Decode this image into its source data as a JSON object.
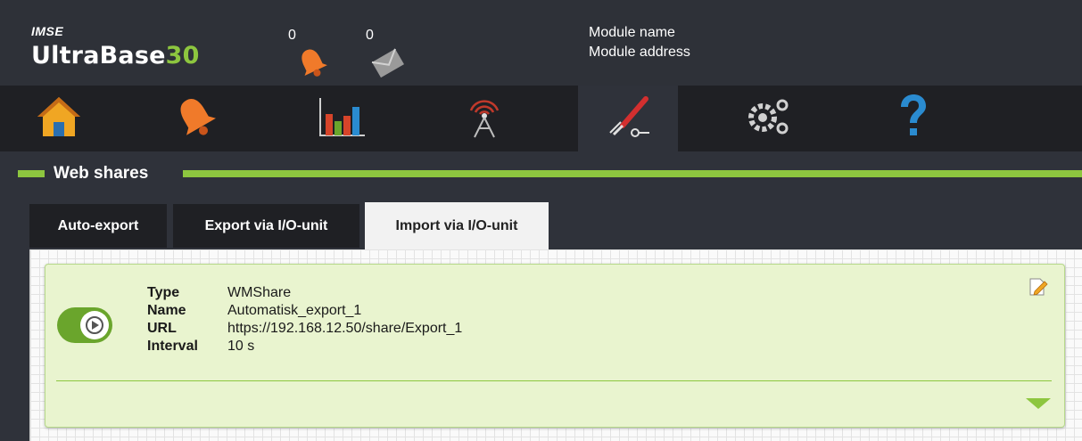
{
  "header": {
    "brand_small": "IMSE",
    "brand_name": "UltraBase",
    "brand_number": "30",
    "alarm_count": "0",
    "message_count": "0",
    "module_name": "Module name",
    "module_address": "Module address"
  },
  "nav": {
    "items": [
      {
        "name": "home-icon"
      },
      {
        "name": "alarm-bell-icon"
      },
      {
        "name": "bar-chart-icon"
      },
      {
        "name": "antenna-icon"
      },
      {
        "name": "tools-icon"
      },
      {
        "name": "gears-icon"
      },
      {
        "name": "help-icon"
      }
    ],
    "active_index": 4
  },
  "section": {
    "title": "Web shares"
  },
  "tabs": [
    {
      "label": "Auto-export"
    },
    {
      "label": "Export via I/O-unit"
    },
    {
      "label": "Import via I/O-unit",
      "active": true
    }
  ],
  "share": {
    "enabled": true,
    "fields": [
      {
        "label": "Type",
        "value": "WMShare"
      },
      {
        "label": "Name",
        "value": "Automatisk_export_1"
      },
      {
        "label": "URL",
        "value": "https://192.168.12.50/share/Export_1"
      },
      {
        "label": "Interval",
        "value": "10 s"
      }
    ]
  },
  "colors": {
    "accent": "#8dc63f",
    "toggle_on": "#6aa52c",
    "card_bg": "#e9f4cf",
    "nav_bg": "#1f2024",
    "header_bg": "#2e3138"
  }
}
